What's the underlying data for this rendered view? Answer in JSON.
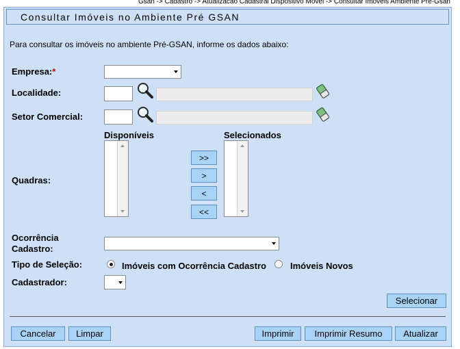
{
  "breadcrumb": "Gsan -> Cadastro -> Atualizacao Cadastral Dispositivo Movel -> Consultar Imoveis Ambiente Pre-Gsan",
  "page_title": "Consultar Imóveis no Ambiente Pré GSAN",
  "intro_text": "Para consultar os imóveis no ambiente Pré-GSAN, informe os dados abaixo:",
  "form": {
    "empresa_label": "Empresa:",
    "required_mark": "*",
    "empresa_value": "",
    "localidade_label": "Localidade:",
    "localidade_code": "",
    "localidade_name": "",
    "setor_label": "Setor Comercial:",
    "setor_code": "",
    "setor_name": "",
    "quadras_label": "Quadras:",
    "disponiveis_label": "Disponíveis",
    "selecionados_label": "Selecionados",
    "move_all_right": ">>",
    "move_right": ">",
    "move_left": "<",
    "move_all_left": "<<",
    "ocorrencia_label_1": "Ocorrência",
    "ocorrencia_label_2": "Cadastro:",
    "ocorrencia_value": "",
    "tipo_selecao_label": "Tipo de Seleção:",
    "tipo_options": [
      {
        "label": "Imóveis com Ocorrência Cadastro",
        "selected": true
      },
      {
        "label": "Imóveis Novos",
        "selected": false
      }
    ],
    "cadastrador_label": "Cadastrador:",
    "cadastrador_value": ""
  },
  "buttons": {
    "selecionar": "Selecionar",
    "cancelar": "Cancelar",
    "limpar": "Limpar",
    "imprimir": "Imprimir",
    "imprimir_resumo": "Imprimir Resumo",
    "atualizar": "Atualizar"
  },
  "icons": {
    "search": "magnifier-icon",
    "clear": "eraser-icon"
  }
}
